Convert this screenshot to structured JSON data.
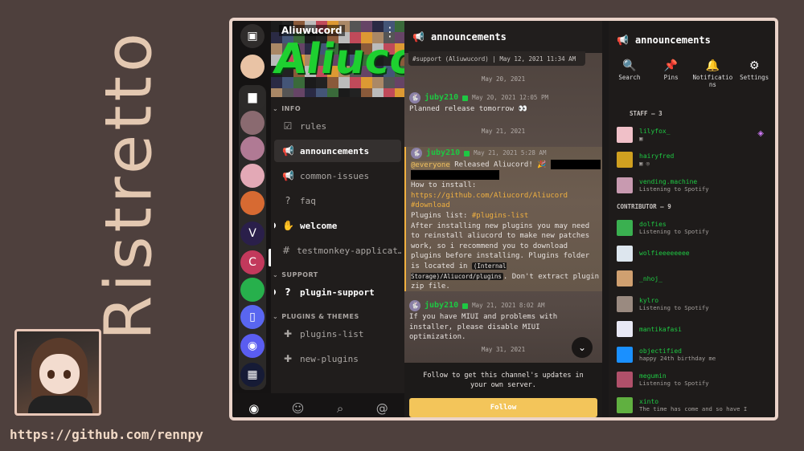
{
  "promo": {
    "title": "Ristretto",
    "github_url": "https://github.com/rennpy"
  },
  "servers": [
    {
      "name": "dms",
      "glyph": "▣",
      "color": "#ffffff",
      "bg": "#2f2c2b"
    },
    {
      "name": "anime",
      "glyph": "",
      "bg": "#e9c3a5"
    },
    {
      "name": "folder",
      "glyph": "▆",
      "bg": "#2c2a29"
    },
    {
      "name": "chibi",
      "glyph": "",
      "bg": "#8a6a70"
    },
    {
      "name": "pink",
      "glyph": "",
      "bg": "#b07a94"
    },
    {
      "name": "pink2",
      "glyph": "",
      "bg": "#e3a9b6"
    },
    {
      "name": "bird",
      "glyph": "",
      "bg": "#d76a32"
    },
    {
      "name": "vite",
      "glyph": "V",
      "bg": "#2a1f4a"
    },
    {
      "name": "aliucord",
      "glyph": "C",
      "bg": "#c2395c"
    },
    {
      "name": "frog",
      "glyph": "",
      "bg": "#27b04c"
    },
    {
      "name": "phone",
      "glyph": "▯",
      "bg": "#5966f0"
    },
    {
      "name": "discord",
      "glyph": "◉",
      "bg": "#5a5df0"
    },
    {
      "name": "cards",
      "glyph": "▦",
      "bg": "#161b36"
    },
    {
      "name": "python",
      "glyph": "",
      "bg": "#3a6fb0"
    }
  ],
  "channel_list": {
    "server_name": "Aliuwucord",
    "banner_logo": "Aliucord",
    "categories": [
      {
        "name": "INFO",
        "channels": [
          {
            "name": "rules",
            "icon": "☑"
          },
          {
            "name": "announcements",
            "icon": "📢",
            "active": true
          },
          {
            "name": "common-issues",
            "icon": "📢"
          },
          {
            "name": "faq",
            "icon": "?"
          },
          {
            "name": "welcome",
            "icon": "✋",
            "unread": true
          },
          {
            "name": "testmonkey-applicat…",
            "icon": "#"
          }
        ]
      },
      {
        "name": "SUPPORT",
        "channels": [
          {
            "name": "plugin-support",
            "icon": "?",
            "unread": true
          }
        ]
      },
      {
        "name": "PLUGINS & THEMES",
        "channels": [
          {
            "name": "plugins-list",
            "icon": "✚"
          },
          {
            "name": "new-plugins",
            "icon": "✚"
          }
        ]
      }
    ]
  },
  "bottom_nav": [
    "discord-icon",
    "friends-icon",
    "search-icon",
    "mentions-icon"
  ],
  "chat": {
    "channel_name": "announcements",
    "reply_bar": "#support (Aliuwucord) | May 12, 2021 11:34 AM",
    "dates": [
      "May 20, 2021",
      "May 21, 2021",
      "May 31, 2021"
    ],
    "messages": [
      {
        "author": "juby210",
        "time": "May 20, 2021 12:05 PM",
        "text": "Planned release tomorrow 👀"
      },
      {
        "author": "juby210",
        "time": "May 21, 2021 5:28 AM",
        "mention": "@everyone",
        "line1": " Released Aliucord! 🎉",
        "how": "How to install:",
        "link": "https://github.com/Aliucord/Aliucord",
        "link2": "#download",
        "plist_label": "Plugins list: ",
        "plist": "#plugins-list",
        "body": "After installing new plugins you may need to reinstall aliucord to make new patches work, so i recommend you to download plugins before installing. Plugins folder is located in ",
        "code": "(Internal Storage)/Aliucord/plugins",
        "body2": ". Don't extract plugin zip file."
      },
      {
        "author": "juby210",
        "time": "May 21, 2021 8:02 AM",
        "text": "If you have MIUI and problems with installer, please disable MIUI optimization."
      }
    ],
    "follow_text": "Follow to get this channel's updates in your own server.",
    "follow_label": "Follow"
  },
  "members": {
    "channel_name": "announcements",
    "tools": [
      {
        "label": "Search",
        "icon": "search-icon",
        "glyph": "🔍"
      },
      {
        "label": "Pins",
        "icon": "pin-icon",
        "glyph": "📌"
      },
      {
        "label": "Notificatio ns",
        "icon": "bell-icon",
        "glyph": "🔔"
      },
      {
        "label": "Settings",
        "icon": "gear-icon",
        "glyph": "⚙"
      }
    ],
    "roles": [
      {
        "name": "STAFF — 3",
        "members": [
          {
            "name": "lilyfox_",
            "status": "▣",
            "color": "#f0c0c8"
          },
          {
            "name": "hairyfred",
            "status": "▣ ◎",
            "color": "#d0a020"
          },
          {
            "name": "vending.machine",
            "status": "Listening to Spotify",
            "color": "#c89ab0"
          }
        ]
      },
      {
        "name": "CONTRIBUTOR — 9",
        "members": [
          {
            "name": "dolfies",
            "status": "Listening to Spotify",
            "color": "#3ab050"
          },
          {
            "name": "wolfieeeeeeee",
            "status": "",
            "color": "#dde6ee"
          },
          {
            "name": "_nhoj_",
            "status": "",
            "color": "#d0a070"
          },
          {
            "name": "kylro",
            "status": "Listening to Spotify",
            "color": "#9a8a80"
          },
          {
            "name": "mantikafasi",
            "status": "",
            "color": "#e8e8f4"
          },
          {
            "name": "objectified",
            "status": "happy 24th birthday me",
            "color": "#1a90ff"
          },
          {
            "name": "megumin",
            "status": "Listening to Spotify",
            "color": "#b0506a"
          },
          {
            "name": "xinto",
            "status": "The time has come and so have I",
            "color": "#60b040"
          }
        ]
      }
    ]
  }
}
